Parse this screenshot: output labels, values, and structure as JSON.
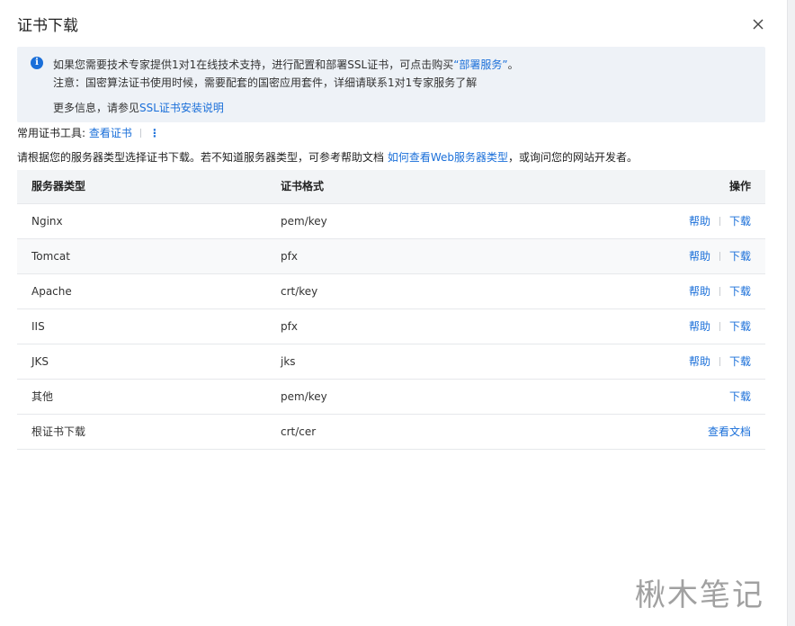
{
  "dialog": {
    "title": "证书下载",
    "close_icon": "close-icon"
  },
  "notice": {
    "icon": "info-icon",
    "icon_glyph": "i",
    "line1_text": "如果您需要技术专家提供1对1在线技术支持，进行配置和部署SSL证书，可点击购买",
    "line1_link": "“部署服务”",
    "line1_end": "。",
    "line2_text": "注意：国密算法证书使用时候，需要配套的国密应用套件，详细请联系1对1专家服务了解",
    "line3_text": "更多信息，请参见",
    "line3_link": "SSL证书安装说明"
  },
  "tools": {
    "label": "常用证书工具:",
    "link": "查看证书",
    "more_icon": "⋮"
  },
  "guide": {
    "text_before": "请根据您的服务器类型选择证书下载。若不知道服务器类型，可参考帮助文档 ",
    "link": "如何查看Web服务器类型",
    "text_after": "，或询问您的网站开发者。"
  },
  "table": {
    "headers": {
      "server": "服务器类型",
      "format": "证书格式",
      "action": "操作"
    },
    "rows": [
      {
        "server": "Nginx",
        "format": "pem/key",
        "help": "帮助",
        "action": "下载"
      },
      {
        "server": "Tomcat",
        "format": "pfx",
        "help": "帮助",
        "action": "下载"
      },
      {
        "server": "Apache",
        "format": "crt/key",
        "help": "帮助",
        "action": "下载"
      },
      {
        "server": "IIS",
        "format": "pfx",
        "help": "帮助",
        "action": "下载"
      },
      {
        "server": "JKS",
        "format": "jks",
        "help": "帮助",
        "action": "下载"
      },
      {
        "server": "其他",
        "format": "pem/key",
        "help": "",
        "action": "下载"
      },
      {
        "server": "根证书下载",
        "format": "crt/cer",
        "help": "",
        "action": "查看文档"
      }
    ]
  },
  "watermark": "楸木笔记",
  "colors": {
    "link": "#1a6fd9",
    "notice_bg": "#eef2f7",
    "header_bg": "#f2f4f6"
  }
}
